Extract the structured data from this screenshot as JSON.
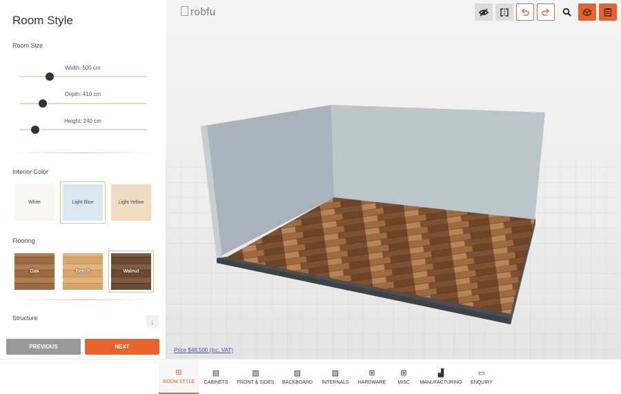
{
  "sidebar": {
    "title": "Room Style",
    "room_size": {
      "label": "Room Size",
      "width": {
        "label": "Width:",
        "value": "500",
        "unit": "cm"
      },
      "depth": {
        "label": "Depth:",
        "value": "410",
        "unit": "cm"
      },
      "height": {
        "label": "Height:",
        "value": "240",
        "unit": "cm"
      }
    },
    "interior_color": {
      "label": "Interior Color",
      "options": [
        "White",
        "Light Blue",
        "Light Yellow"
      ],
      "selected": "Light Blue"
    },
    "flooring": {
      "label": "Flooring",
      "options": [
        "Oak",
        "Beech",
        "Walnut"
      ],
      "selected": "Walnut"
    },
    "structure": {
      "label": "Structure"
    },
    "previous_label": "PREVIOUS",
    "next_label": "NEXT"
  },
  "viewport": {
    "logo": "robfu",
    "price": "Price $48,500 (inc. VAT)"
  },
  "toolbar": {
    "icons": [
      "eye-off-icon",
      "split-view-icon",
      "undo-icon",
      "redo-icon",
      "zoom-icon",
      "cube-3d-icon",
      "clipboard-icon"
    ]
  },
  "tabs": [
    {
      "label": "ROOM STYLE",
      "icon": "room-style-icon"
    },
    {
      "label": "CABINETS",
      "icon": "cabinets-icon"
    },
    {
      "label": "FRONT & SIDES",
      "icon": "hatch-icon"
    },
    {
      "label": "BACKBOARD",
      "icon": "hatch-icon"
    },
    {
      "label": "INTERNALS",
      "icon": "hatch-icon"
    },
    {
      "label": "HARDWARE",
      "icon": "grid-plus-icon"
    },
    {
      "label": "MISC",
      "icon": "grid-plus-icon"
    },
    {
      "label": "MANUFACTURING",
      "icon": "factory-icon"
    },
    {
      "label": "ENQUIRY",
      "icon": "chat-icon"
    }
  ],
  "active_tab": "ROOM STYLE",
  "colors": {
    "accent": "#e8632c",
    "previous_button": "#999999",
    "white_swatch": "#f7f6f3",
    "light_blue_swatch": "#dce8f0",
    "light_yellow_swatch": "#f1dcc1"
  }
}
